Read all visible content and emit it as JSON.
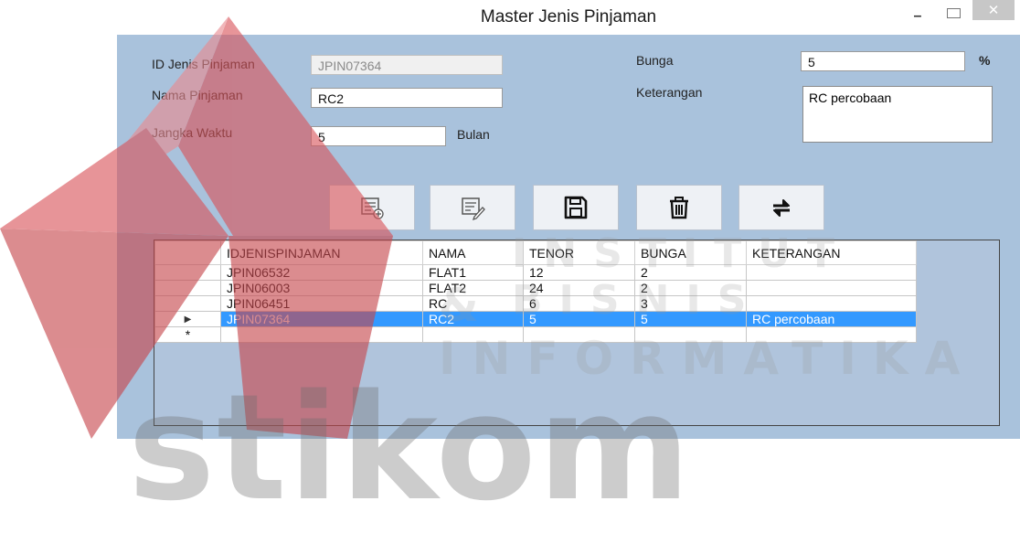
{
  "window": {
    "title": "Master Jenis Pinjaman"
  },
  "form": {
    "id_label": "ID Jenis Pinjaman",
    "id_value": "JPIN07364",
    "nama_label": "Nama Pinjaman",
    "nama_value": "RC2",
    "jangka_label": "Jangka Waktu",
    "jangka_value": "5",
    "jangka_unit": "Bulan",
    "bunga_label": "Bunga",
    "bunga_value": "5",
    "bunga_unit": "%",
    "ket_label": "Keterangan",
    "ket_value": "RC percobaan"
  },
  "toolbar": {
    "icons": [
      "new-record-icon",
      "edit-record-icon",
      "save-icon",
      "delete-icon",
      "refresh-icon"
    ]
  },
  "grid": {
    "headers": [
      "IDJENISPINJAMAN",
      "NAMA",
      "TENOR",
      "BUNGA",
      "KETERANGAN"
    ],
    "rows": [
      [
        "JPIN06532",
        "FLAT1",
        "12",
        "2",
        ""
      ],
      [
        "JPIN06003",
        "FLAT2",
        "24",
        "2",
        ""
      ],
      [
        "JPIN06451",
        "RC",
        "6",
        "3",
        ""
      ],
      [
        "JPIN07364",
        "RC2",
        "5",
        "5",
        "RC percobaan"
      ]
    ],
    "selected_index": 3,
    "current_row_marker": "▶",
    "new_row_marker": "*"
  },
  "watermark": {
    "line1": "INSTITUT BISNIS",
    "line2": "& INFORMATIKA",
    "big": "stikom"
  },
  "colors": {
    "window_bg": "#a9c2dc",
    "selection": "#3399ff",
    "watermark_red": "#d94a4a"
  }
}
